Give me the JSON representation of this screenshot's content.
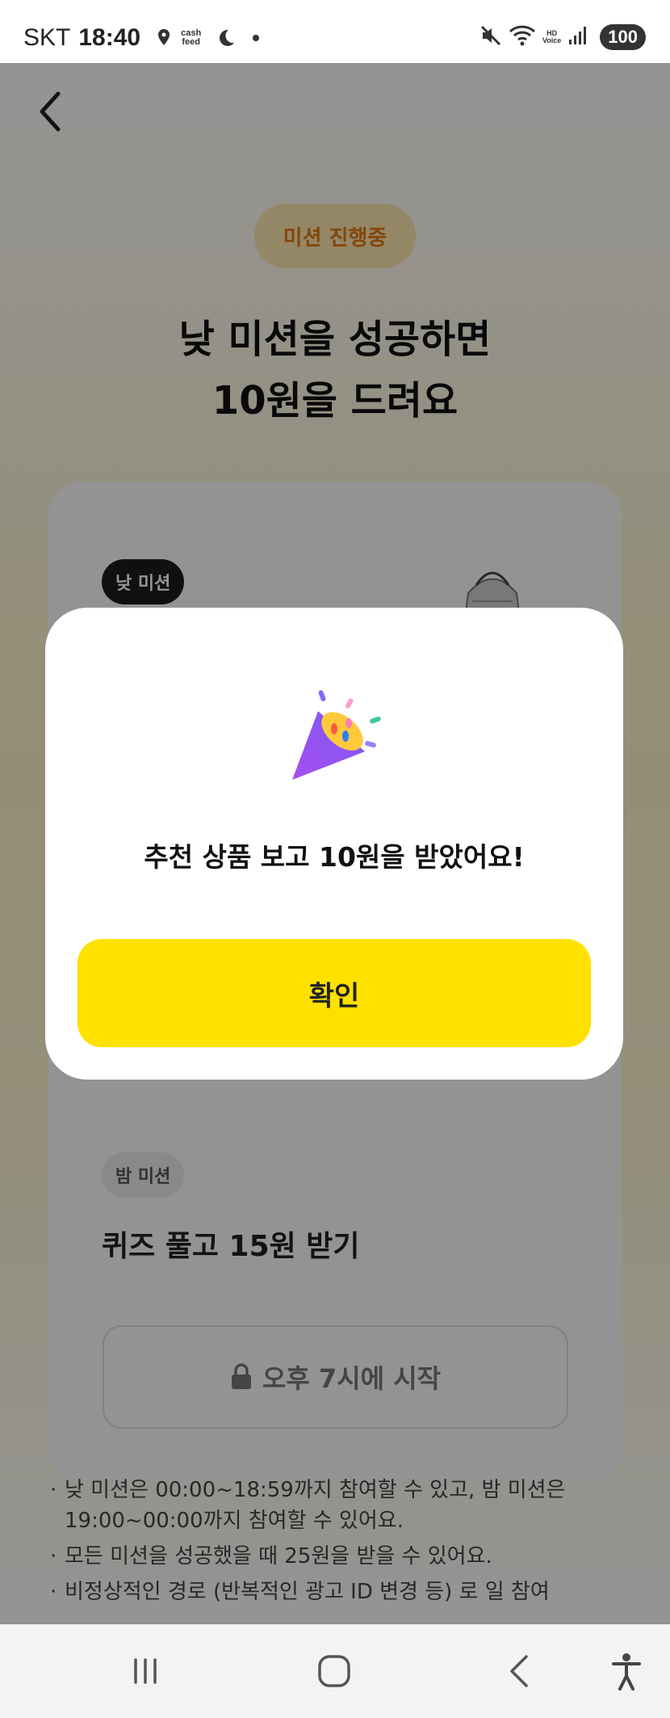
{
  "status_bar": {
    "carrier": "SKT",
    "time": "18:40",
    "cashfeed_icon_text_1": "cash",
    "cashfeed_icon_text_2": "feed",
    "hd_voice_1": "HD",
    "hd_voice_2": "Voice",
    "battery": "100"
  },
  "page": {
    "status_pill": "미션 진행중",
    "headline_line1": "낮 미션을 성공하면",
    "headline_line2": "10원을 드려요",
    "day_tag": "낮 미션",
    "night_tag": "밤 미션",
    "night_title": "퀴즈 풀고 15원 받기",
    "night_locked_label": "오후 7시에 시작",
    "notes": [
      "낮 미션은 00:00~18:59까지 참여할 수 있고, 밤 미션은 19:00~00:00까지 참여할 수 있어요.",
      "모든 미션을 성공했을 때 25원을 받을 수 있어요.",
      "비정상적인 경로 (반복적인 광고 ID 변경 등) 로 일 참여"
    ]
  },
  "modal": {
    "message": "추천 상품 보고 10원을 받았어요!",
    "confirm_label": "확인"
  },
  "colors": {
    "accent_yellow": "#ffe100",
    "pill_text": "#e07b18",
    "pill_bg": "#ffe9b0"
  }
}
